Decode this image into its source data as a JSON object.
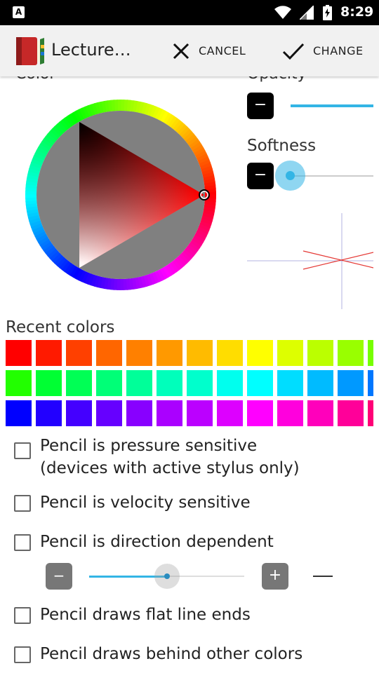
{
  "status_bar": {
    "time": "8:29",
    "icons": [
      "notification-a-icon",
      "wifi-icon",
      "signal-icon",
      "battery-charging-icon"
    ]
  },
  "app_bar": {
    "title": "Lecture…",
    "cancel_label": "CANCEL",
    "change_label": "CHANGE",
    "icons": [
      "notebook-app-icon",
      "close-icon",
      "check-icon"
    ]
  },
  "picker": {
    "color_label": "Color",
    "opacity_label": "Opacity",
    "opacity_minus": "−",
    "opacity_level": 1.0,
    "softness_label": "Softness",
    "softness_minus": "−",
    "softness_level": 0.0
  },
  "recent": {
    "label": "Recent colors",
    "rows": [
      [
        "#ff0000",
        "#ff1a00",
        "#ff4000",
        "#ff6600",
        "#ff8000",
        "#ff9900",
        "#ffbb00",
        "#ffdd00",
        "#ffff00",
        "#ddff00",
        "#bbff00",
        "#99ff00",
        "#77ff00"
      ],
      [
        "#22ff00",
        "#00ff33",
        "#00ff55",
        "#00ff77",
        "#00ff99",
        "#00ffbb",
        "#00ffcc",
        "#00ffee",
        "#00ffff",
        "#00ddff",
        "#00bbff",
        "#0099ff",
        "#0077ff"
      ],
      [
        "#0000ff",
        "#2200ff",
        "#4400ff",
        "#6600ff",
        "#8800ff",
        "#aa00ff",
        "#bb00ff",
        "#dd00ff",
        "#ff00ff",
        "#ff00dd",
        "#ff00bb",
        "#ff0099",
        "#ff0077"
      ]
    ]
  },
  "options": {
    "pressure_line1": "Pencil is pressure sensitive",
    "pressure_line2": "(devices with active stylus only)",
    "velocity": "Pencil is velocity sensitive",
    "direction": "Pencil is direction dependent",
    "direction_minus": "−",
    "direction_plus": "+",
    "direction_level": 0.5,
    "flat_ends": "Pencil draws flat line ends",
    "behind": "Pencil draws behind other colors"
  },
  "colors": {
    "accent": "#33b5e5",
    "selected_hue": "#ff0000"
  }
}
